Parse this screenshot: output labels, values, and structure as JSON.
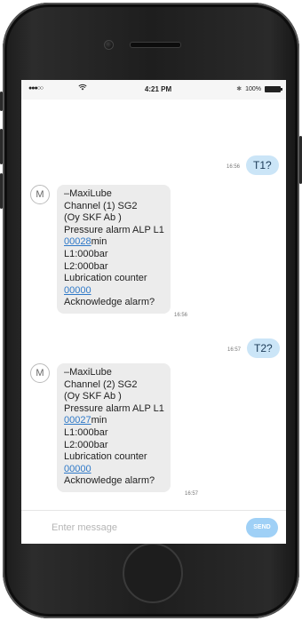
{
  "status_bar": {
    "signal": "●●●○○",
    "wifi_icon": "wifi-icon",
    "time": "4:21 PM",
    "bluetooth": "✱",
    "battery": "100%"
  },
  "messages": [
    {
      "direction": "out",
      "text": "T1?",
      "time": "16:56"
    },
    {
      "direction": "in",
      "avatar": "M",
      "time": "16:56",
      "lines": [
        {
          "text": "–MaxiLube"
        },
        {
          "text": "Channel (1) SG2"
        },
        {
          "text": "(Oy SKF Ab )"
        },
        {
          "text": "Pressure alarm ALP L1"
        },
        {
          "link": "00028",
          "suffix": "min"
        },
        {
          "text": "L1:000bar"
        },
        {
          "text": "L2:000bar"
        },
        {
          "text": "Lubrication counter"
        },
        {
          "link": "00000",
          "suffix": ""
        },
        {
          "text": "Acknowledge alarm?"
        }
      ]
    },
    {
      "direction": "out",
      "text": "T2?",
      "time": "16:57"
    },
    {
      "direction": "in",
      "avatar": "M",
      "time": "16:57",
      "lines": [
        {
          "text": "–MaxiLube"
        },
        {
          "text": "Channel (2) SG2"
        },
        {
          "text": "(Oy SKF Ab )"
        },
        {
          "text": "Pressure alarm ALP L1"
        },
        {
          "link": "00027",
          "suffix": "min"
        },
        {
          "text": "L1:000bar"
        },
        {
          "text": "L2:000bar"
        },
        {
          "text": "Lubrication counter"
        },
        {
          "link": "00000",
          "suffix": ""
        },
        {
          "text": "Acknowledge alarm?"
        }
      ]
    }
  ],
  "compose": {
    "placeholder": "Enter message",
    "send_label": "SEND"
  },
  "colors": {
    "outgoing_bubble": "#cbe5f7",
    "incoming_bubble": "#ececec",
    "link": "#2f79c8",
    "send_button": "#9fd0f6"
  }
}
